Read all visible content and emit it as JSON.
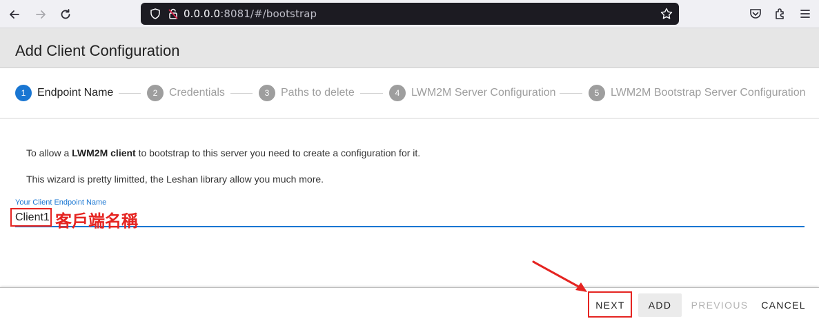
{
  "browser": {
    "url_host": "0.0.0.0",
    "url_rest": ":8081/#/bootstrap",
    "icons": [
      "back-icon",
      "forward-icon",
      "reload-icon",
      "shield-icon",
      "permissions-icon",
      "bookmark-star-icon",
      "pocket-icon",
      "extensions-icon",
      "menu-icon"
    ]
  },
  "page": {
    "title": "Add Client Configuration"
  },
  "stepper": {
    "steps": [
      {
        "num": "1",
        "label": "Endpoint Name",
        "active": true
      },
      {
        "num": "2",
        "label": "Credentials",
        "active": false
      },
      {
        "num": "3",
        "label": "Paths to delete",
        "active": false
      },
      {
        "num": "4",
        "label": "LWM2M Server Configuration",
        "active": false
      },
      {
        "num": "5",
        "label": "LWM2M Bootstrap Server Configuration",
        "active": false
      }
    ]
  },
  "content": {
    "intro_prefix": "To allow a ",
    "intro_bold": "LWM2M client",
    "intro_suffix": " to bootstrap to this server you need to create a configuration for it.",
    "note": "This wizard is pretty limitted, the Leshan library allow you much more.",
    "field_label": "Your Client Endpoint Name",
    "field_value": "Client1",
    "annotation": "客戶端名稱"
  },
  "footer": {
    "next": "NEXT",
    "add": "ADD",
    "previous": "PREVIOUS",
    "cancel": "CANCEL"
  },
  "colors": {
    "accent": "#1976d2",
    "highlight": "#e52421"
  }
}
